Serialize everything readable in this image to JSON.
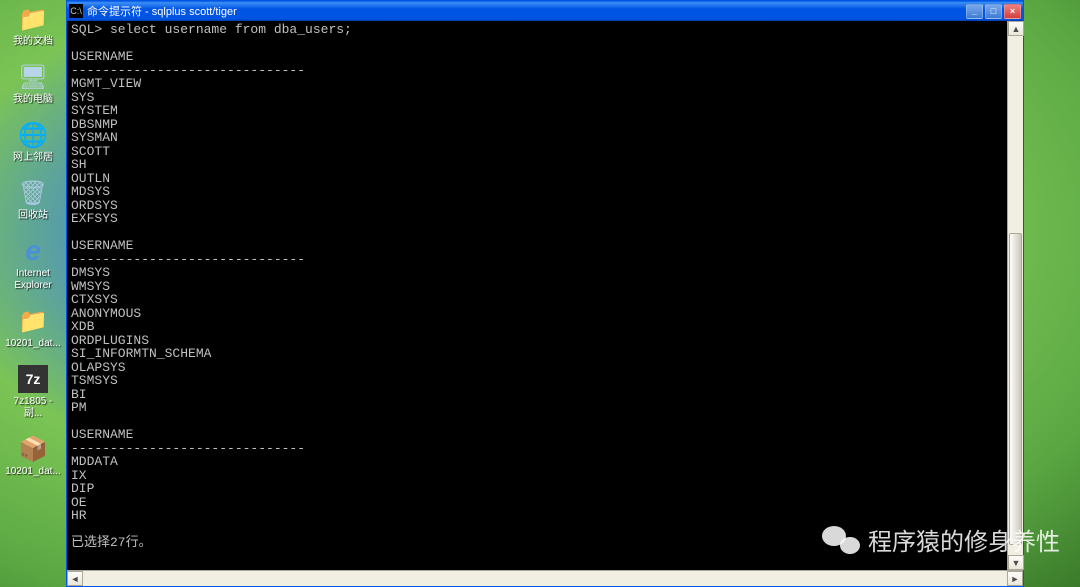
{
  "desktop": {
    "icons": [
      {
        "label": "我的文档",
        "iconName": "my-documents-icon",
        "glyph": "📁"
      },
      {
        "label": "我的电脑",
        "iconName": "my-computer-icon",
        "glyph": "🖥"
      },
      {
        "label": "网上邻居",
        "iconName": "network-icon",
        "glyph": "🌐"
      },
      {
        "label": "回收站",
        "iconName": "recycle-bin-icon",
        "glyph": "🗑"
      },
      {
        "label": "Internet\nExplorer",
        "iconName": "ie-icon",
        "glyph": "e"
      },
      {
        "label": "10201_dat...",
        "iconName": "folder-icon-1",
        "glyph": "📁"
      },
      {
        "label": "7z1805 - 副...",
        "iconName": "7z-icon",
        "glyph": "7z"
      },
      {
        "label": "10201_dat...",
        "iconName": "zip-icon",
        "glyph": "📦"
      }
    ]
  },
  "window": {
    "title": "命令提示符 - sqlplus scott/tiger",
    "titlebarIconText": "C:\\",
    "buttons": {
      "minimize": "_",
      "maximize": "□",
      "close": "×"
    }
  },
  "terminal": {
    "prompt": "SQL> ",
    "command": "select username from dba_users;",
    "columnHeader": "USERNAME",
    "divider": "------------------------------",
    "block1": [
      "MGMT_VIEW",
      "SYS",
      "SYSTEM",
      "DBSNMP",
      "SYSMAN",
      "SCOTT",
      "SH",
      "OUTLN",
      "MDSYS",
      "ORDSYS",
      "EXFSYS"
    ],
    "block2": [
      "DMSYS",
      "WMSYS",
      "CTXSYS",
      "ANONYMOUS",
      "XDB",
      "ORDPLUGINS",
      "SI_INFORMTN_SCHEMA",
      "OLAPSYS",
      "TSMSYS",
      "BI",
      "PM"
    ],
    "block3": [
      "MDDATA",
      "IX",
      "DIP",
      "OE",
      "HR"
    ],
    "footer": "已选择27行。"
  },
  "watermark": {
    "text": "程序猿的修身养性"
  },
  "scrollArrows": {
    "left": "◄",
    "right": "►",
    "up": "▲",
    "down": "▼"
  }
}
